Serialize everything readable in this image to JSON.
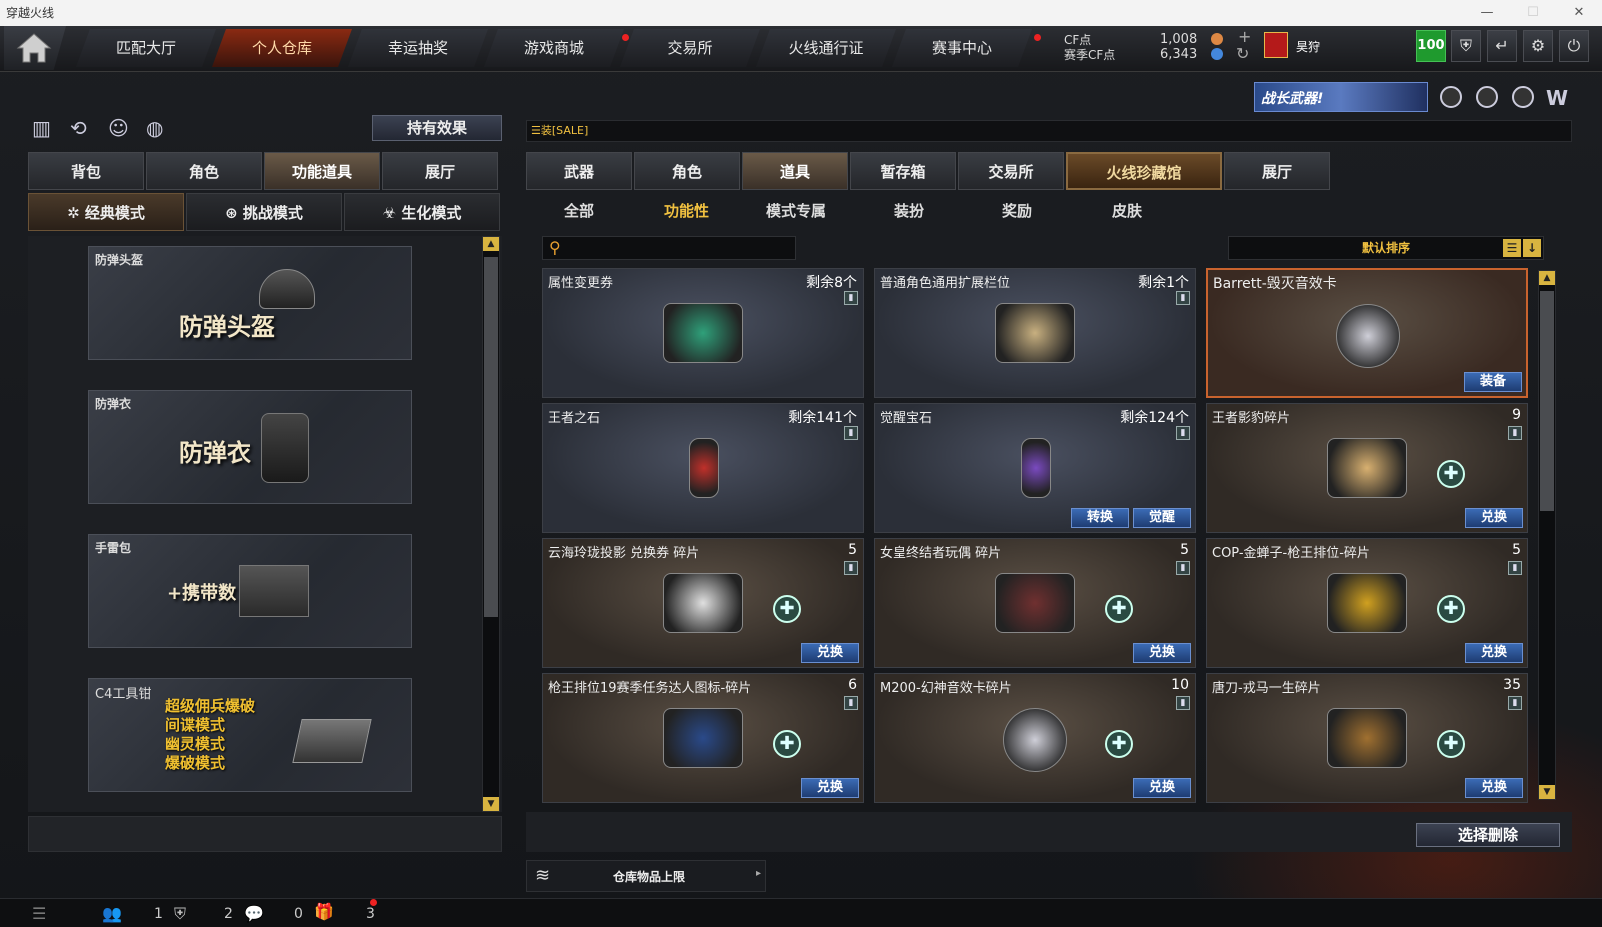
{
  "window": {
    "title": "穿越火线",
    "min": "—",
    "max": "☐",
    "close": "✕"
  },
  "nav": {
    "tabs": [
      "匹配大厅",
      "个人仓库",
      "幸运抽奖",
      "游戏商城",
      "交易所",
      "火线通行证",
      "赛事中心"
    ],
    "cf_label": "CF点",
    "season_cf_label": "赛季CF点",
    "cf_value": "1,008",
    "season_cf_value": "6,343",
    "plus": "+",
    "refresh": "↻",
    "username": "昊狩",
    "level": "100"
  },
  "banner": "战长武器!",
  "left": {
    "icon_row": [
      "bars-icon",
      "refresh-icon",
      "person-icon",
      "grenade-icon"
    ],
    "effect_button": "持有效果",
    "tabs": [
      "背包",
      "角色",
      "功能道具",
      "展厅"
    ],
    "modes": [
      "经典模式",
      "挑战模式",
      "生化模式"
    ],
    "cards": [
      {
        "name": "防弹头盔",
        "big": "防弹头盔"
      },
      {
        "name": "防弹衣",
        "big": "防弹衣"
      },
      {
        "name": "手雷包",
        "big": "+携带数"
      },
      {
        "name": "C4工具钳",
        "lines": [
          "超级佣兵爆破",
          "间谍模式",
          "幽灵模式",
          "爆破模式"
        ]
      }
    ]
  },
  "right": {
    "sale": "[SALE]",
    "sale_prefix": "☰装",
    "tabs": [
      "武器",
      "角色",
      "道具",
      "暂存箱",
      "交易所",
      "火线珍藏馆",
      "展厅"
    ],
    "subtabs": [
      "全部",
      "功能性",
      "模式专属",
      "装扮",
      "奖励",
      "皮肤"
    ],
    "search_placeholder": "",
    "sort_label": "默认排序",
    "items": [
      {
        "name": "属性变更券",
        "count": "剩余8个",
        "btns": []
      },
      {
        "name": "普通角色通用扩展栏位",
        "count": "剩余1个",
        "btns": []
      },
      {
        "name": "Barrett-毁灭音效卡",
        "count": "",
        "btns": [
          "装备"
        ]
      },
      {
        "name": "王者之石",
        "count": "剩余141个",
        "btns": []
      },
      {
        "name": "觉醒宝石",
        "count": "剩余124个",
        "btns": [
          "转换",
          "觉醒"
        ]
      },
      {
        "name": "王者影豹碎片",
        "count": "9",
        "btns": [
          "兑换"
        ]
      },
      {
        "name": "云海玲珑投影 兑换券 碎片",
        "count": "5",
        "btns": [
          "兑换"
        ]
      },
      {
        "name": "女皇终结者玩偶 碎片",
        "count": "5",
        "btns": [
          "兑换"
        ]
      },
      {
        "name": "COP-金蝉子-枪王排位-碎片",
        "count": "5",
        "btns": [
          "兑换"
        ]
      },
      {
        "name": "枪王排位19赛季任务达人图标-碎片",
        "count": "6",
        "btns": [
          "兑换"
        ]
      },
      {
        "name": "M200-幻神音效卡碎片",
        "count": "10",
        "btns": [
          "兑换"
        ]
      },
      {
        "name": "唐刀-戎马一生碎片",
        "count": "35",
        "btns": [
          "兑换"
        ]
      }
    ],
    "delete_button": "选择删除",
    "capacity_label": "仓库物品上限"
  },
  "bottom": {
    "counts": [
      "1",
      "2",
      "0",
      "3"
    ]
  }
}
